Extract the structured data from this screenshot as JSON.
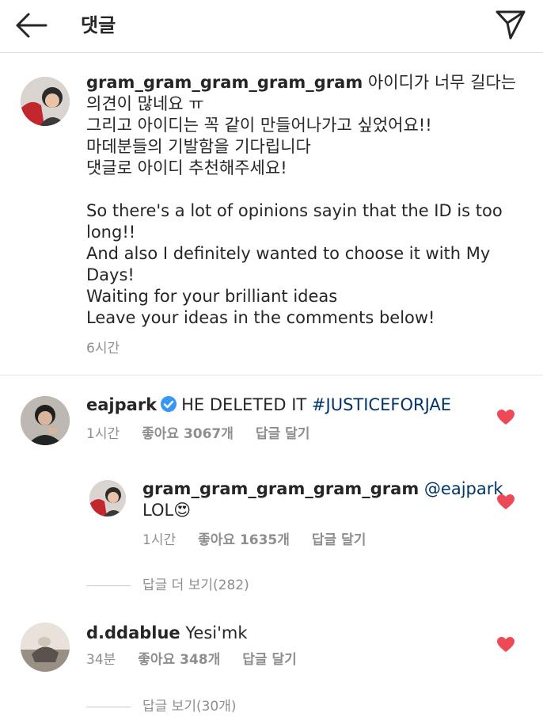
{
  "header": {
    "title": "댓글",
    "back_icon": "arrow-left-icon",
    "send_icon": "paper-plane-icon"
  },
  "post": {
    "username": "gram_gram_gram_gram_gram",
    "caption": " 아이디가 너무 길다는 의견이 많네요 ㅠ\n그리고 아이디는 꼭 같이 만들어나가고 싶었어요!!\n마데분들의 기발함을 기다립니다\n댓글로 아이디 추천해주세요!\n\nSo there's a lot of opinions sayin that the ID is too long!!\nAnd also I definitely wanted to choose it with My Days!\nWaiting for your brilliant ideas\nLeave your ideas in the comments below!",
    "time": "6시간"
  },
  "comments": [
    {
      "username": "eajpark",
      "verified": true,
      "text": "HE DELETED IT ",
      "hashtag": "#JUSTICEFORJAE",
      "time": "1시간",
      "likes": "좋아요 3067개",
      "reply": "답글 달기",
      "liked": true
    },
    {
      "username": "gram_gram_gram_gram_gram",
      "mention": "@eajpark",
      "text": "LOL",
      "emoji": "😍",
      "time": "1시간",
      "likes": "좋아요 1635개",
      "reply": "답글 달기",
      "liked": true
    },
    {
      "view_replies": "답글 더 보기(282)"
    },
    {
      "username": "d.ddablue",
      "text": "Yesi'mk",
      "time": "34분",
      "likes": "좋아요 348개",
      "reply": "답글 달기",
      "liked": true
    },
    {
      "view_replies": "답글 보기(30개)"
    }
  ],
  "colors": {
    "heart": "#ed4956",
    "verified": "#3897f0",
    "link": "#003569",
    "meta": "#8e8e8e"
  }
}
